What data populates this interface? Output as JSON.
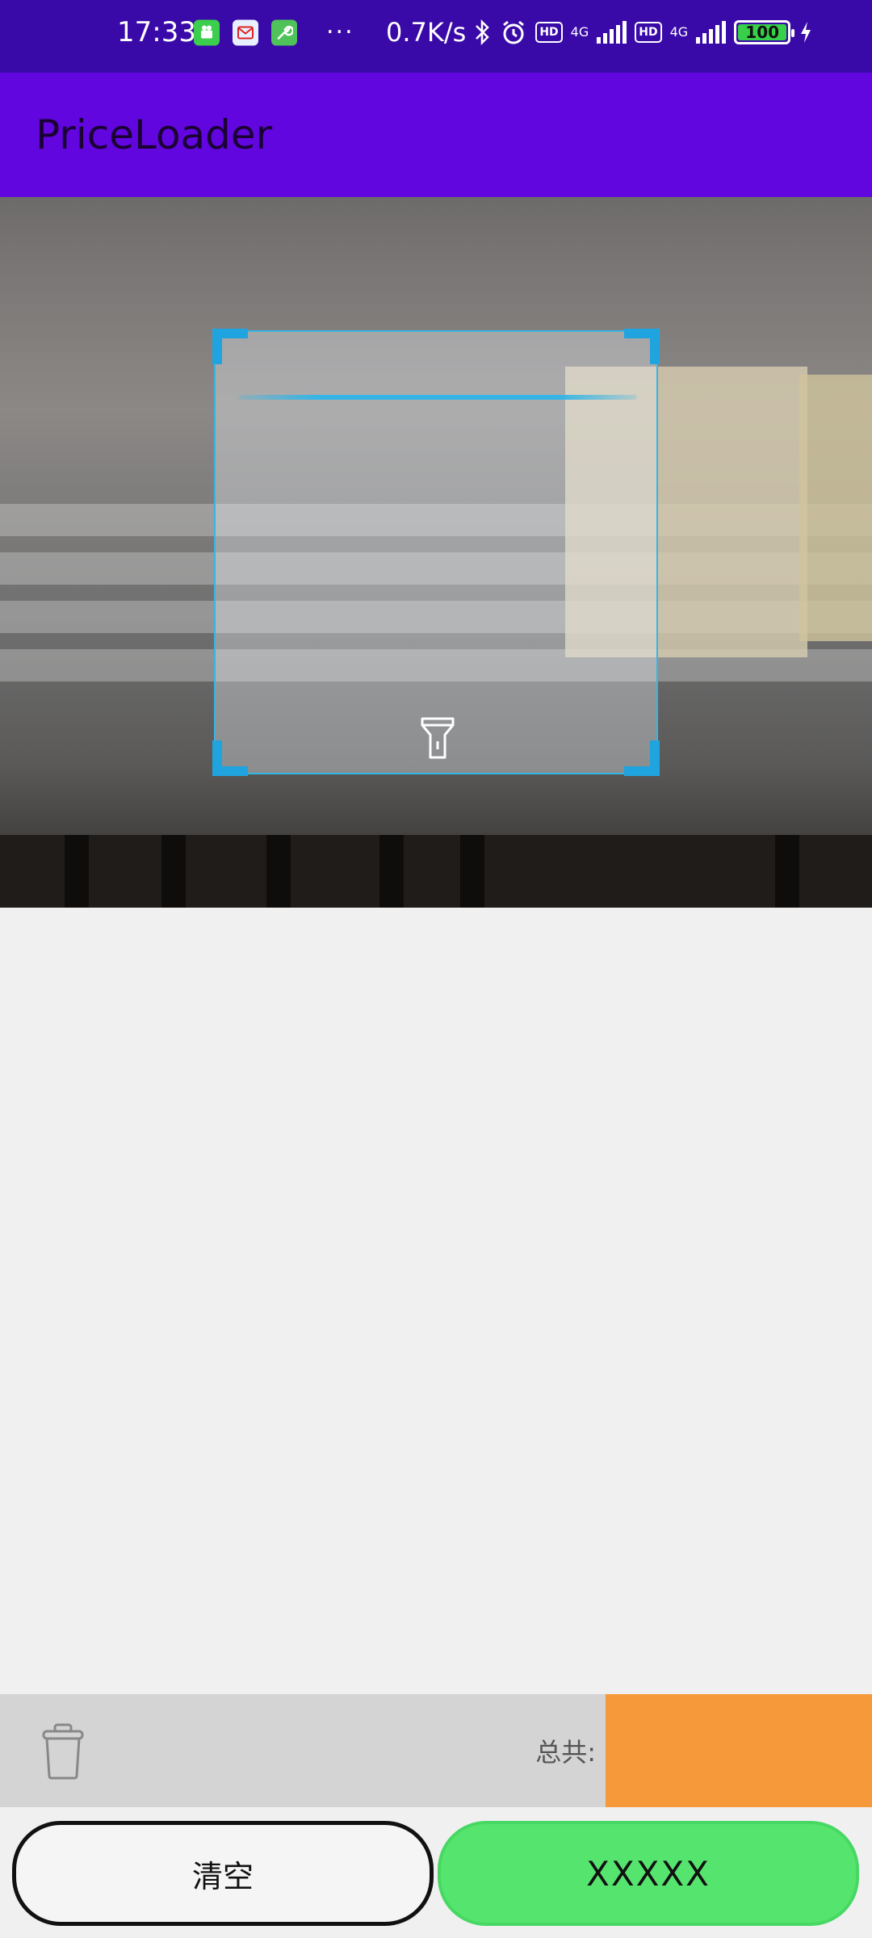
{
  "status_bar": {
    "time": "17:33",
    "notification_icons": [
      "android-icon",
      "mail-app-icon",
      "wrench-icon"
    ],
    "more": "···",
    "net_speed": "0.7K/s",
    "hd_label": "HD",
    "network_type": "4G",
    "battery_level": "100"
  },
  "app_bar": {
    "title": "PriceLoader"
  },
  "scanner": {
    "flashlight_icon": "flashlight-icon"
  },
  "summary": {
    "trash_icon": "trash-icon",
    "total_label": "总共:",
    "total_value": "",
    "total_box_color": "#f6993a"
  },
  "buttons": {
    "clear_label": "清空",
    "confirm_label": "XXXXX",
    "confirm_color": "#55e56e"
  },
  "colors": {
    "status_bar": "#3a0aa8",
    "app_bar": "#6206e0",
    "scan_accent": "#35b5e5"
  }
}
